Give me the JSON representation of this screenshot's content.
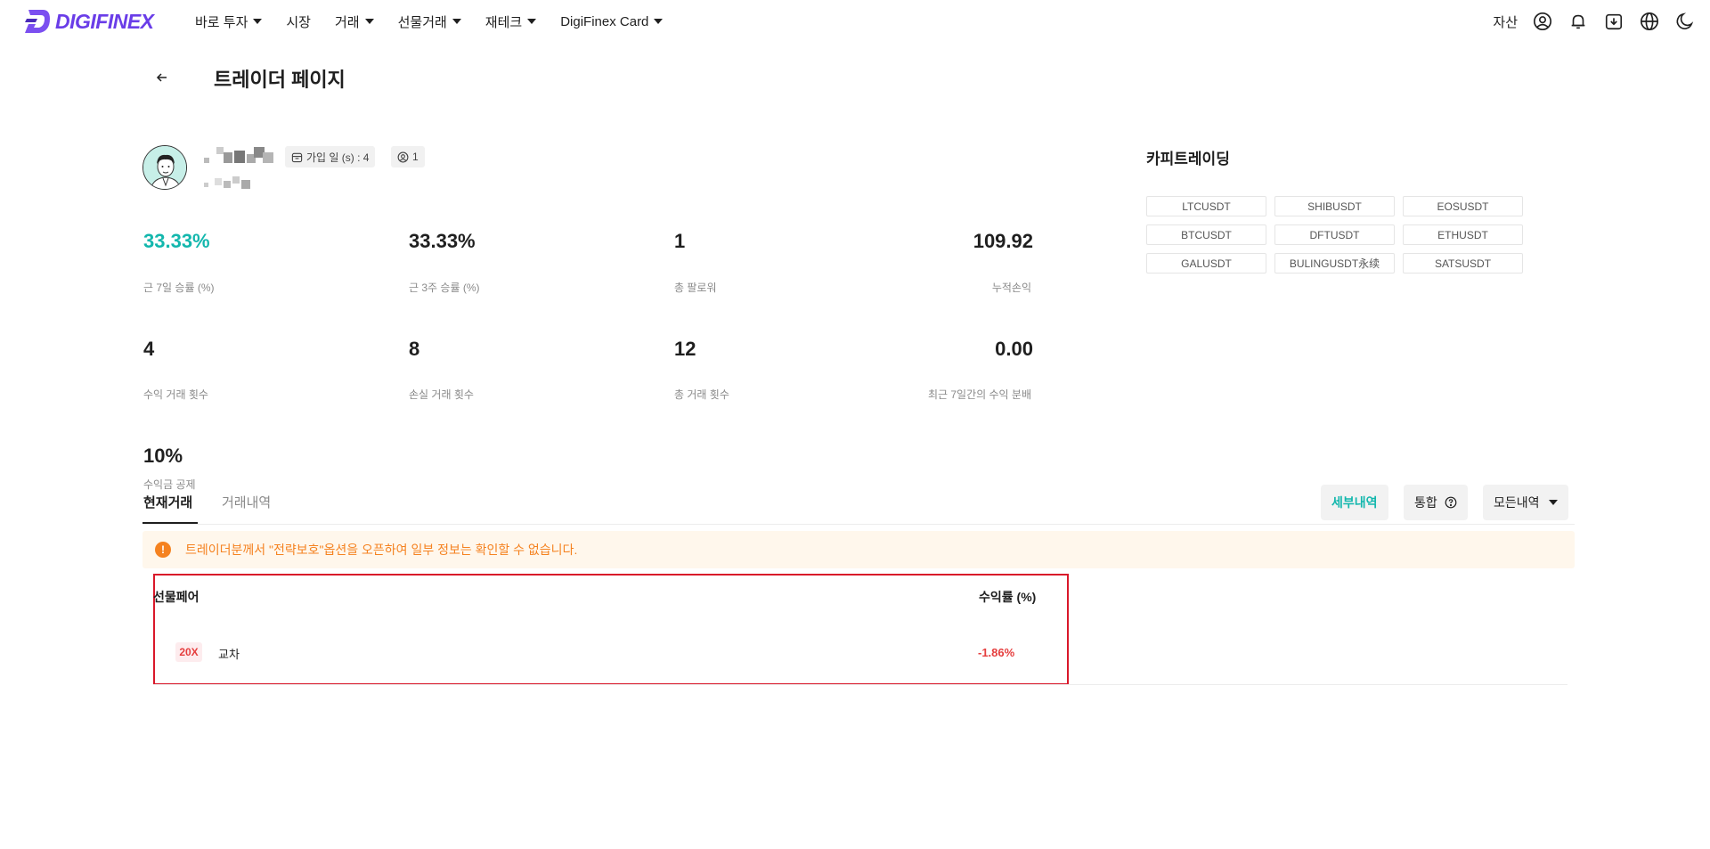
{
  "header": {
    "logo_text": "DIGIFINEX",
    "nav": [
      {
        "label": "바로 투자",
        "has_dropdown": true
      },
      {
        "label": "시장",
        "has_dropdown": false
      },
      {
        "label": "거래",
        "has_dropdown": true
      },
      {
        "label": "선물거래",
        "has_dropdown": true
      },
      {
        "label": "재테크",
        "has_dropdown": true
      },
      {
        "label": "DigiFinex Card",
        "has_dropdown": true
      }
    ],
    "asset_label": "자산",
    "icons": [
      "user-icon",
      "bell-icon",
      "download-icon",
      "globe-icon",
      "moon-icon"
    ]
  },
  "page": {
    "title": "트레이더 페이지"
  },
  "profile": {
    "join_days_label": "가입 일 (s) : 4",
    "followers_badge": "1"
  },
  "stats": {
    "win_rate_7d": {
      "value": "33.33%",
      "label": "근 7일 승률 (%)"
    },
    "win_rate_3w": {
      "value": "33.33%",
      "label": "근 3주 승률 (%)"
    },
    "total_followers": {
      "value": "1",
      "label": "총 팔로워"
    },
    "cumulative_pnl": {
      "value": "109.92",
      "label": "누적손익"
    },
    "profit_trades": {
      "value": "4",
      "label": "수익 거래 횟수"
    },
    "loss_trades": {
      "value": "8",
      "label": "손실 거래 횟수"
    },
    "total_trades": {
      "value": "12",
      "label": "총 거래 횟수"
    },
    "profit_share_7d": {
      "value": "0.00",
      "label": "최근 7일간의 수익 분배"
    },
    "profit_deduction": {
      "value": "10%",
      "label": "수익금 공제"
    }
  },
  "copy_trading": {
    "title": "카피트레이딩",
    "pairs": [
      "LTCUSDT",
      "SHIBUSDT",
      "EOSUSDT",
      "BTCUSDT",
      "DFTUSDT",
      "ETHUSDT",
      "GALUSDT",
      "BULINGUSDT永续",
      "SATSUSDT"
    ]
  },
  "tabs": {
    "current": "현재거래",
    "history": "거래내역",
    "active": "current"
  },
  "actions": {
    "detail": "세부내역",
    "merge": "통합",
    "all_history": "모든내역"
  },
  "notice": {
    "text": "트레이더분께서 \"전략보호\"옵션을 오픈하여 일부 정보는 확인할 수 없습니다."
  },
  "table": {
    "col_pair": "선물페어",
    "col_return": "수익률 (%)",
    "rows": [
      {
        "leverage": "20X",
        "mode": "교차",
        "return": "-1.86%"
      }
    ]
  },
  "colors": {
    "brand": "#6a3de8",
    "accent": "#13b7ad",
    "negative": "#e53e3e",
    "warning": "#f58220"
  }
}
